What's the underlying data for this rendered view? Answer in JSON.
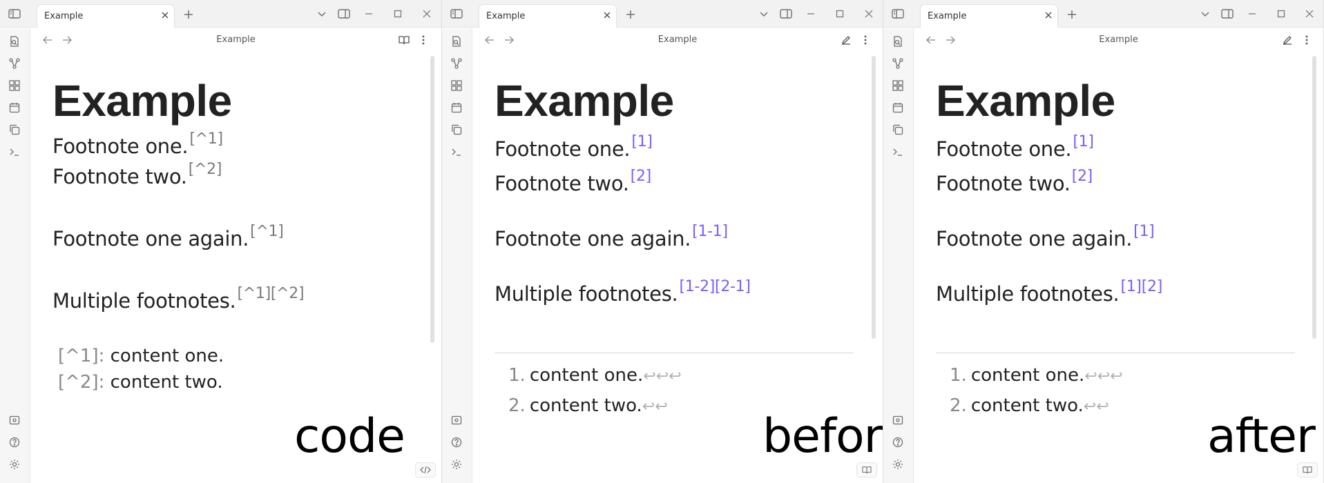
{
  "panes": [
    {
      "tab_title": "Example",
      "view_title": "Example",
      "heading": "Example",
      "mode": "code",
      "lines": [
        {
          "text": "Footnote one.",
          "refs": "[^1]"
        },
        {
          "text": "Footnote two.",
          "refs": "[^2]"
        },
        {
          "text": "Footnote one again.",
          "refs": "[^1]"
        },
        {
          "text": "Multiple footnotes.",
          "refs": "[^1][^2]"
        }
      ],
      "footnotes": [
        {
          "label": "[^1]:",
          "text": "content one."
        },
        {
          "label": "[^2]:",
          "text": "content two."
        }
      ],
      "overlay_label": "code"
    },
    {
      "tab_title": "Example",
      "view_title": "Example",
      "heading": "Example",
      "mode": "preview",
      "lines": [
        {
          "text": "Footnote one.",
          "refs": "[1]"
        },
        {
          "text": "Footnote two.",
          "refs": "[2]"
        },
        {
          "text": "Footnote one again.",
          "refs": "[1-1]"
        },
        {
          "text": "Multiple footnotes.",
          "refs": "[1-2][2-1]"
        }
      ],
      "footnotes": [
        {
          "num": "1.",
          "text": "content one.",
          "backrefs": "↩↩↩"
        },
        {
          "num": "2.",
          "text": "content two.",
          "backrefs": "↩↩"
        }
      ],
      "overlay_label": "before"
    },
    {
      "tab_title": "Example",
      "view_title": "Example",
      "heading": "Example",
      "mode": "preview",
      "lines": [
        {
          "text": "Footnote one.",
          "refs": "[1]"
        },
        {
          "text": "Footnote two.",
          "refs": "[2]"
        },
        {
          "text": "Footnote one again.",
          "refs": "[1]"
        },
        {
          "text": "Multiple footnotes.",
          "refs": "[1][2]"
        }
      ],
      "footnotes": [
        {
          "num": "1.",
          "text": "content one.",
          "backrefs": "↩↩↩"
        },
        {
          "num": "2.",
          "text": "content two.",
          "backrefs": "↩↩"
        }
      ],
      "overlay_label": "after"
    }
  ],
  "colors": {
    "footnote_link": "#7b5cff",
    "raw_syntax": "#7a7a7a",
    "backref": "#b0b0b0"
  },
  "icons": {
    "tabbar": [
      "sidebar-toggle-icon",
      "close-icon",
      "plus-icon",
      "chevron-down-icon",
      "split-view-icon",
      "minimize-icon",
      "maximize-icon",
      "window-close-icon"
    ],
    "ribbon": [
      "new-note-icon",
      "graph-icon",
      "canvas-icon",
      "calendar-icon",
      "copy-icon",
      "terminal-icon",
      "vault-icon",
      "help-icon",
      "settings-icon"
    ],
    "view_header": [
      "back-arrow-icon",
      "forward-arrow-icon",
      "reading-mode-icon",
      "edit-mode-icon",
      "more-options-icon"
    ]
  }
}
